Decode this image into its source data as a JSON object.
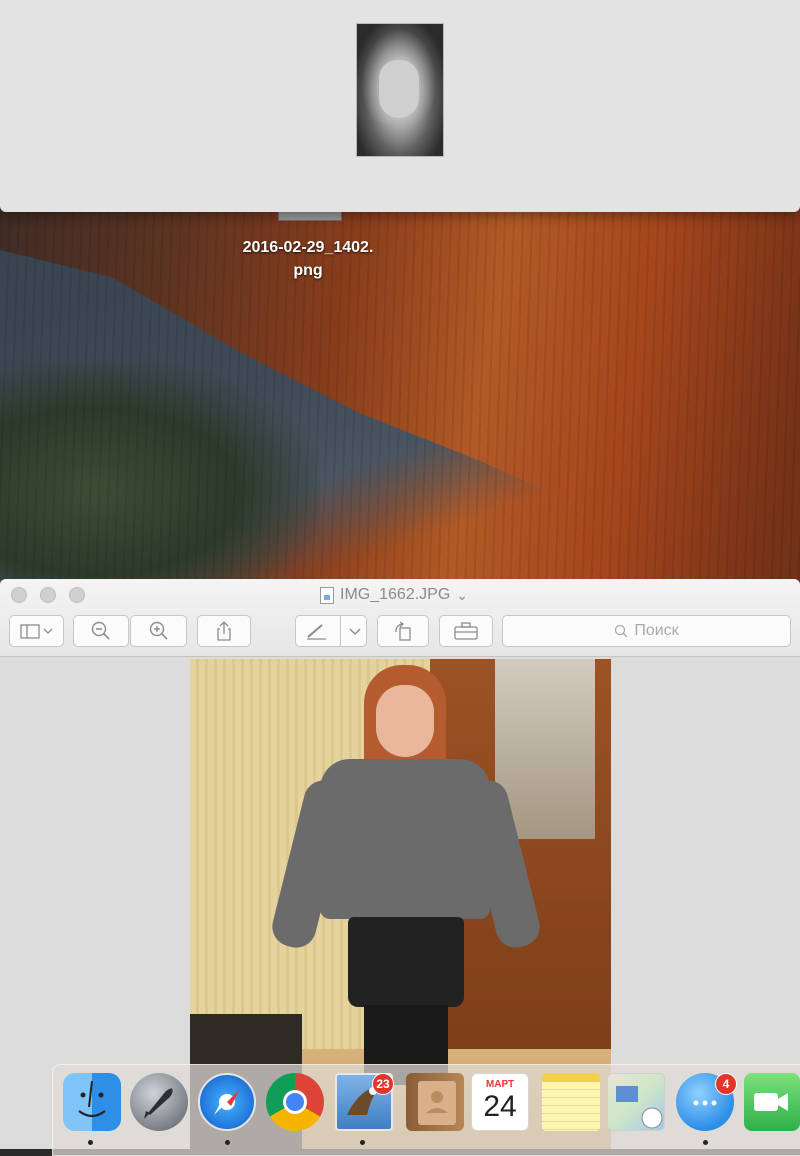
{
  "desktop": {
    "file_label_line1": "2016-02-29_1402.",
    "file_label_line2": "png"
  },
  "preview": {
    "title": "IMG_1662.JPG",
    "title_chevron": "⌄",
    "toolbar": {
      "sidebar_icon": "sidebar-icon",
      "zoom_out_icon": "zoom-out-icon",
      "zoom_in_icon": "zoom-in-icon",
      "share_icon": "share-icon",
      "markup_icon": "pen-icon",
      "rotate_icon": "rotate-icon",
      "toolbox_icon": "toolbox-icon"
    },
    "search": {
      "placeholder": "Поиск"
    }
  },
  "dock": {
    "items": [
      {
        "name": "Finder"
      },
      {
        "name": "Launchpad"
      },
      {
        "name": "Safari"
      },
      {
        "name": "Chrome"
      },
      {
        "name": "Mail",
        "badge": "23"
      },
      {
        "name": "Contacts"
      },
      {
        "name": "Calendar",
        "month": "МАРТ",
        "day": "24"
      },
      {
        "name": "Notes"
      },
      {
        "name": "Maps"
      },
      {
        "name": "Messages",
        "badge": "4"
      },
      {
        "name": "FaceTime"
      }
    ]
  },
  "colors": {
    "badge_red": "#e2362b",
    "window_bg": "#dcdcdc",
    "accent_blue": "#1e88e5"
  }
}
